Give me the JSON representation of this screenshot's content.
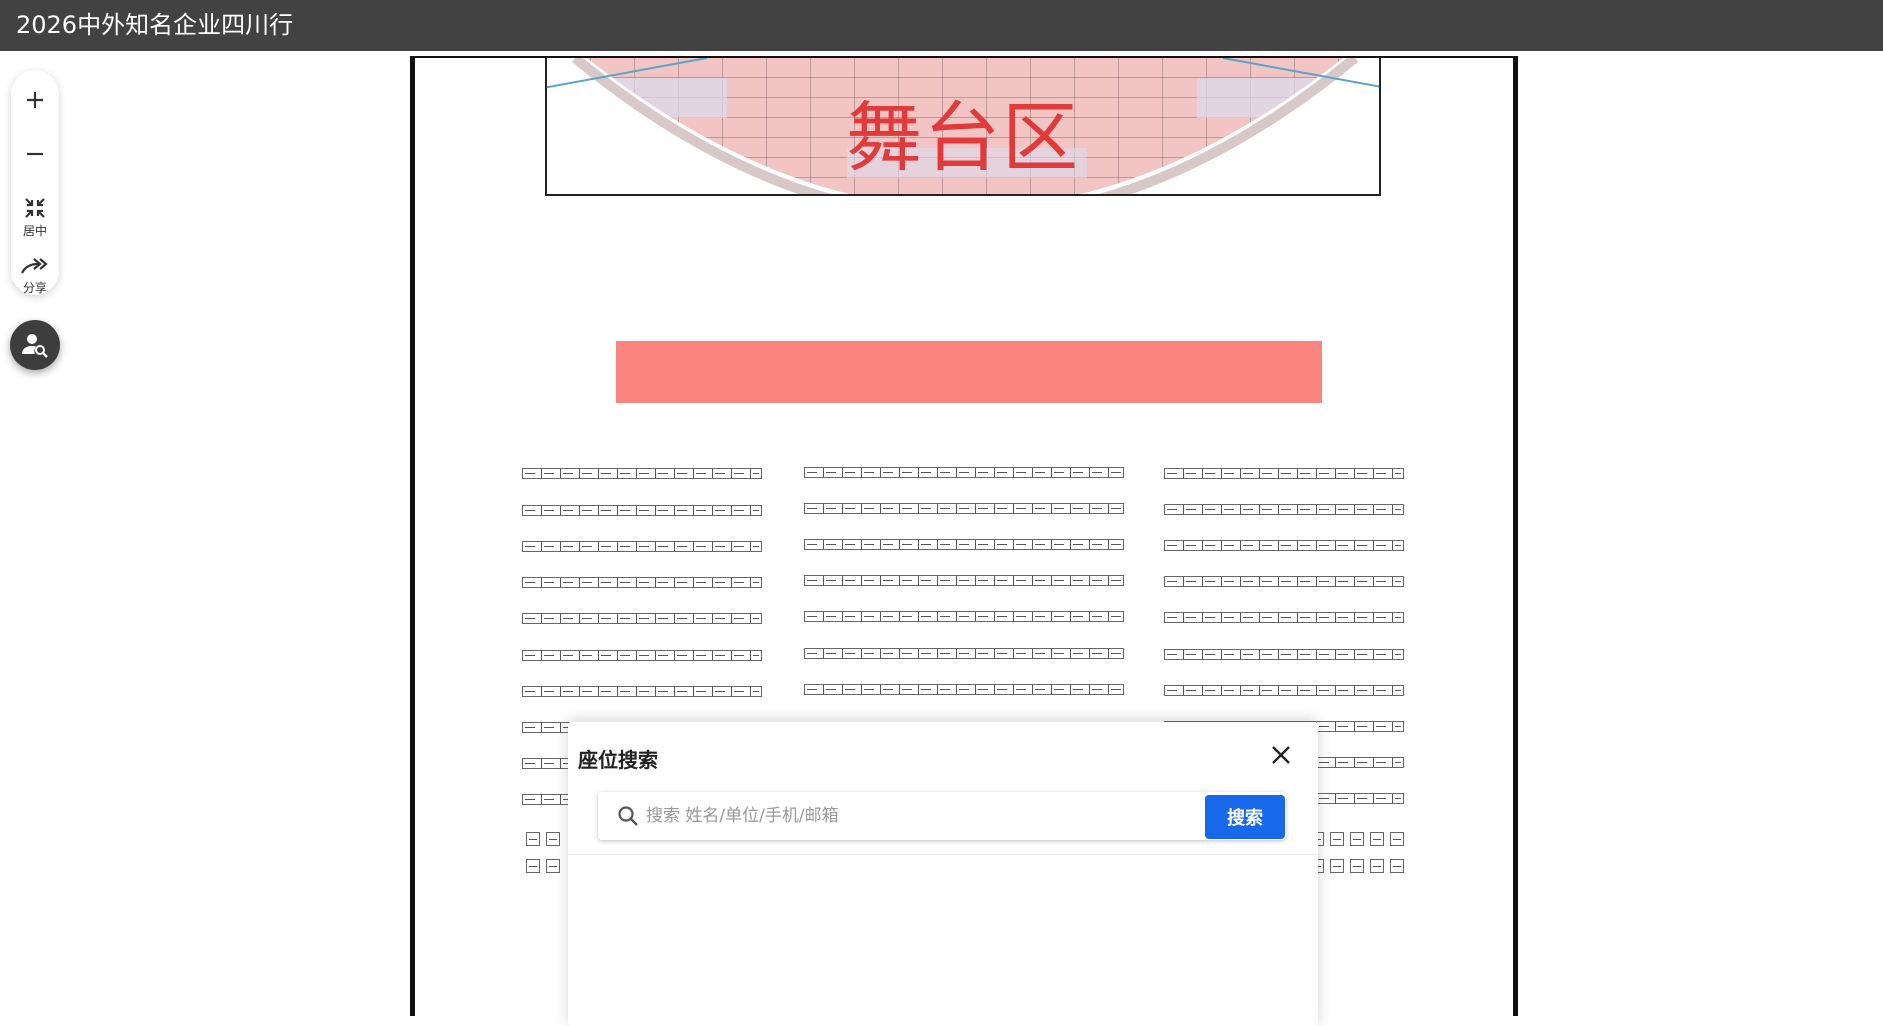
{
  "header": {
    "title": "2026中外知名企业四川行"
  },
  "toolbar": {
    "zoom_in_icon": "plus-icon",
    "zoom_out_icon": "minus-icon",
    "center_label": "居中",
    "share_label": "分享"
  },
  "floorplan": {
    "stage_label": "舞台区",
    "stage_color": "#e03a3a",
    "highlight_bar_color": "#fa8580"
  },
  "search_dialog": {
    "title": "座位搜索",
    "input_placeholder": "搜索 姓名/单位/手机/邮箱",
    "input_value": "",
    "search_button_label": "搜索",
    "accent_color": "#1769ea"
  }
}
